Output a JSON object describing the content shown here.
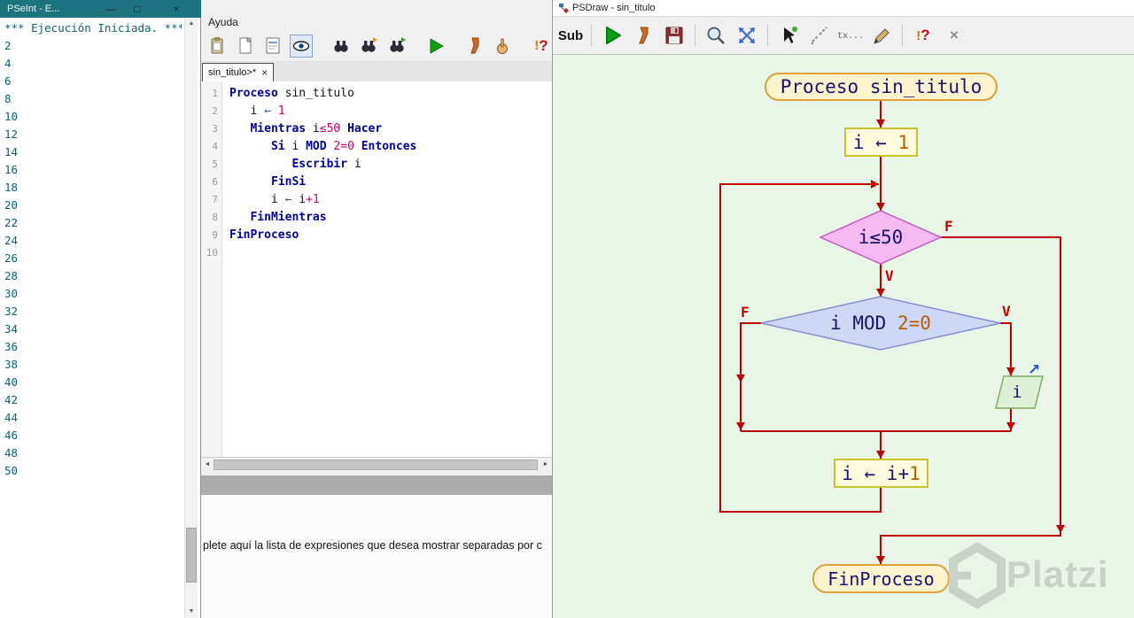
{
  "console": {
    "title": "PSeInt - E...",
    "lines": [
      "*** Ejecución Iniciada. ***",
      "2",
      "4",
      "6",
      "8",
      "10",
      "12",
      "14",
      "16",
      "18",
      "20",
      "22",
      "24",
      "26",
      "28",
      "30",
      "32",
      "34",
      "36",
      "38",
      "40",
      "42",
      "44",
      "46",
      "48",
      "50"
    ]
  },
  "editor": {
    "menu": {
      "ayuda": "Ayuda"
    },
    "tab": {
      "label": "sin_titulo>*",
      "close": "×"
    },
    "code": {
      "lines": [
        {
          "n": "1",
          "segs": [
            {
              "t": "Proceso",
              "c": "kw"
            },
            {
              "t": " sin_titulo",
              "c": "pl"
            }
          ]
        },
        {
          "n": "2",
          "segs": [
            {
              "t": "   i ",
              "c": "pl"
            },
            {
              "t": "←",
              "c": "ar"
            },
            {
              "t": " ",
              "c": "pl"
            },
            {
              "t": "1",
              "c": "num"
            }
          ]
        },
        {
          "n": "3",
          "segs": [
            {
              "t": "   ",
              "c": "pl"
            },
            {
              "t": "Mientras",
              "c": "kw"
            },
            {
              "t": " i",
              "c": "pl"
            },
            {
              "t": "≤50",
              "c": "num"
            },
            {
              "t": " ",
              "c": "pl"
            },
            {
              "t": "Hacer",
              "c": "kw"
            }
          ]
        },
        {
          "n": "4",
          "segs": [
            {
              "t": "      ",
              "c": "pl"
            },
            {
              "t": "Si",
              "c": "kw"
            },
            {
              "t": " i ",
              "c": "pl"
            },
            {
              "t": "MOD",
              "c": "kw"
            },
            {
              "t": " ",
              "c": "pl"
            },
            {
              "t": "2=0",
              "c": "num"
            },
            {
              "t": " ",
              "c": "pl"
            },
            {
              "t": "Entonces",
              "c": "kw"
            }
          ]
        },
        {
          "n": "5",
          "segs": [
            {
              "t": "         ",
              "c": "pl"
            },
            {
              "t": "Escribir",
              "c": "kw"
            },
            {
              "t": " i",
              "c": "pl"
            }
          ]
        },
        {
          "n": "6",
          "segs": [
            {
              "t": "      ",
              "c": "pl"
            },
            {
              "t": "FinSi",
              "c": "kw"
            }
          ]
        },
        {
          "n": "7",
          "segs": [
            {
              "t": "      i ",
              "c": "pl"
            },
            {
              "t": "←",
              "c": "ar"
            },
            {
              "t": " i",
              "c": "pl"
            },
            {
              "t": "+1",
              "c": "num"
            }
          ]
        },
        {
          "n": "8",
          "segs": [
            {
              "t": "   ",
              "c": "pl"
            },
            {
              "t": "FinMientras",
              "c": "kw"
            }
          ]
        },
        {
          "n": "9",
          "segs": [
            {
              "t": "FinProceso",
              "c": "kw"
            }
          ]
        },
        {
          "n": "10",
          "segs": []
        }
      ]
    },
    "help_text": "plete aquí la lista de expresiones que desea mostrar separadas por c"
  },
  "psdraw": {
    "title": "PSDraw - sin_titulo",
    "toolbar": {
      "sub": "Sub",
      "tx": "tx..."
    },
    "flowchart": {
      "start": [
        {
          "t": "Proceso sin_titulo",
          "c": "fc"
        }
      ],
      "assign1": [
        {
          "t": "i ← ",
          "c": "fc"
        },
        {
          "t": "1",
          "c": "fn"
        }
      ],
      "while_cond": [
        {
          "t": "i≤50",
          "c": "fc"
        }
      ],
      "if_cond": [
        {
          "t": "i MOD ",
          "c": "fc"
        },
        {
          "t": "2=0",
          "c": "fn"
        }
      ],
      "output": [
        {
          "t": "i",
          "c": "fc"
        }
      ],
      "assign2": [
        {
          "t": "i ← i+",
          "c": "fc"
        },
        {
          "t": "1",
          "c": "fn"
        }
      ],
      "end": [
        {
          "t": "FinProceso",
          "c": "fc"
        }
      ],
      "labels": {
        "while_false": "F",
        "while_true": "V",
        "if_false": "F",
        "if_true": "V"
      },
      "output_icon": "↗"
    },
    "watermark": "Platzi"
  },
  "icons": {
    "minimize": "—",
    "maximize": "□",
    "close": "×",
    "scroll_up": "▲",
    "scroll_down": "▼",
    "scroll_left": "◄",
    "scroll_right": "►",
    "bang": "!",
    "q": "?"
  },
  "colors": {
    "connector_red": "#c00000",
    "canvas_green": "#e9f6e7",
    "titlebar_teal": "#1e7380",
    "keyword_blue": "#0000a8",
    "number_pink": "#d4006a",
    "flow_text_navy": "#15156e",
    "flow_number_orange": "#b85c00",
    "start_end_fill": "#fcf3cf",
    "start_end_border": "#dfa13a",
    "process_fill": "#fffbdc",
    "decision_pink": "#f6b9f2",
    "decision_blue": "#ccd8f6",
    "output_green": "#dff0d8"
  }
}
